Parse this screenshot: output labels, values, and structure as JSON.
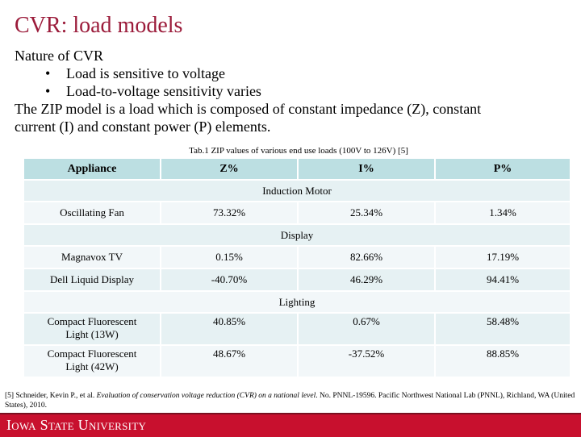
{
  "slide": {
    "title": "CVR: load models",
    "body": {
      "heading": "Nature of CVR",
      "bullets": [
        "Load is sensitive to voltage",
        "Load-to-voltage sensitivity varies"
      ],
      "bullet_glyph": "•",
      "paragraph_line1": "The ZIP model is a load which is composed of constant impedance (Z), constant",
      "paragraph_line2": "current (I) and constant power (P) elements."
    },
    "table": {
      "caption": "Tab.1 ZIP values of various end use loads (100V to 126V) [5]",
      "headers": [
        "Appliance",
        "Z%",
        "I%",
        "P%"
      ],
      "groups": [
        {
          "name": "Induction Motor",
          "rows": [
            {
              "appliance": "Oscillating Fan",
              "z": "73.32%",
              "i": "25.34%",
              "p": "1.34%"
            }
          ]
        },
        {
          "name": "Display",
          "rows": [
            {
              "appliance": "Magnavox TV",
              "z": "0.15%",
              "i": "82.66%",
              "p": "17.19%"
            },
            {
              "appliance": "Dell Liquid Display",
              "z": "-40.70%",
              "i": "46.29%",
              "p": "94.41%"
            }
          ]
        },
        {
          "name": "Lighting",
          "rows": [
            {
              "appliance_line1": "Compact Fluorescent",
              "appliance_line2": "Light (13W)",
              "z": "40.85%",
              "i": "0.67%",
              "p": "58.48%"
            },
            {
              "appliance_line1": "Compact Fluorescent",
              "appliance_line2": "Light (42W)",
              "z": "48.67%",
              "i": "-37.52%",
              "p": "88.85%"
            }
          ]
        }
      ]
    },
    "reference": {
      "prefix": "[5] Schneider, Kevin P., et al. ",
      "title_italic": "Evaluation of conservation voltage reduction (CVR) on a national level",
      "suffix": ". No. PNNL-19596. Pacific Northwest National Lab (PNNL), Richland, WA (United States), 2010."
    },
    "footer": {
      "logo_text": "Iowa State University",
      "brand_color": "#c8102e"
    }
  }
}
